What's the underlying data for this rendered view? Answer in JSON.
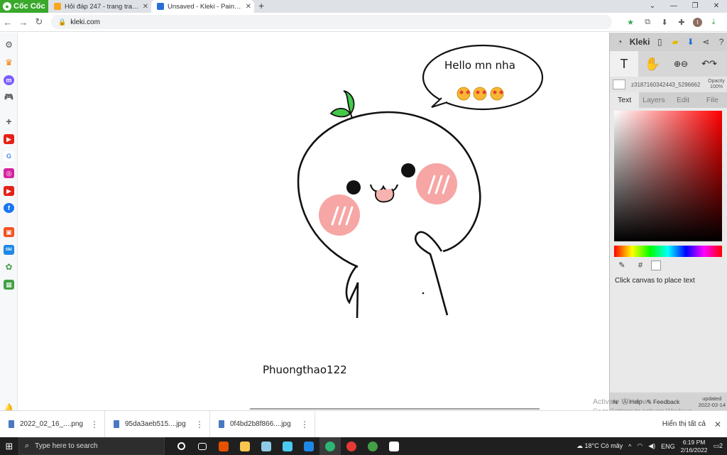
{
  "browser": {
    "brand": "Cốc Cốc",
    "tabs": [
      {
        "title": "Hỏi đáp 247 - trang tra loi",
        "active": false,
        "favicon_color": "#f5a623"
      },
      {
        "title": "Unsaved - Kleki - Paint Tool",
        "active": true,
        "favicon_color": "#2a6fd6"
      }
    ],
    "new_tab": "+",
    "url": "kleki.com"
  },
  "canvas_drawing": {
    "bubble_text": "Hello mn nha",
    "signature": "Phuongthao122"
  },
  "kleki": {
    "app_name": "Kleki",
    "layer_name": "z3187160342443_5296662",
    "opacity_label": "Opacity",
    "opacity_value": "100%",
    "tabs": [
      "Text",
      "Layers",
      "Edit",
      "File"
    ],
    "selected_tab": "Text",
    "hint": "Click canvas to place text",
    "hex_symbol": "#",
    "footer_help": "Help",
    "footer_feedback": "Feedback",
    "updated_label": "updated",
    "updated_date": "2022-02-14"
  },
  "watermark": {
    "line1": "Activate Windows",
    "line2": "Go to Settings to activate Windows."
  },
  "downloads": {
    "items": [
      "2022_02_16_....png",
      "95da3aeb515....jpg",
      "0f4bd2b8f866....jpg"
    ],
    "show_all": "Hiển thị tất cả"
  },
  "taskbar": {
    "search_placeholder": "Type here to search",
    "weather": "18°C Có mây",
    "language": "ENG",
    "time": "6:19 PM",
    "date": "2/16/2022",
    "notifications": "2"
  }
}
